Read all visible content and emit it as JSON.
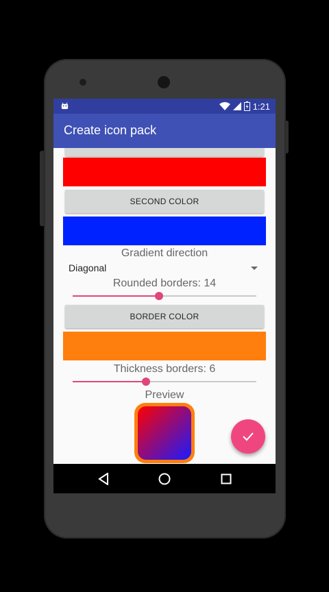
{
  "status": {
    "time": "1:21"
  },
  "appbar": {
    "title": "Create icon pack"
  },
  "first_color": {
    "swatch": "#ff0000"
  },
  "second_color": {
    "button_label": "SECOND COLOR",
    "swatch": "#0022ff"
  },
  "gradient": {
    "label": "Gradient direction",
    "selected": "Diagonal"
  },
  "rounded": {
    "label": "Rounded borders: 14",
    "value_fraction": 0.47
  },
  "border_color": {
    "button_label": "BORDER COLOR",
    "swatch": "#ff7f0e"
  },
  "thickness": {
    "label": "Thickness borders: 6",
    "value_fraction": 0.4
  },
  "preview": {
    "label": "Preview",
    "gradient_start": "#ff0000",
    "gradient_end": "#1a1aff",
    "border": "#ff7f0e"
  },
  "colors": {
    "primary": "#3f51b5",
    "primary_dark": "#303f9f",
    "accent": "#f0467f"
  },
  "icons": {
    "fab": "check-icon",
    "nav": [
      "back-icon",
      "home-icon",
      "recents-icon"
    ]
  }
}
